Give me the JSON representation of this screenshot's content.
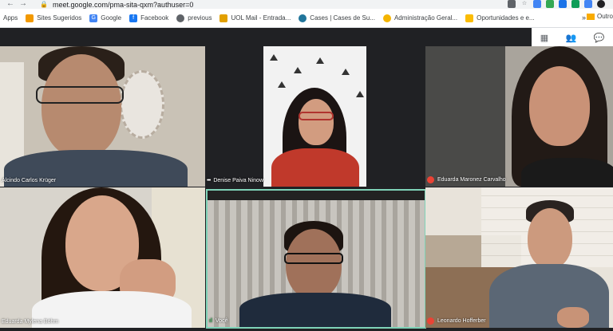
{
  "browser": {
    "url": "meet.google.com/pma-sita-qxm?authuser=0"
  },
  "bookmarks": [
    {
      "label": "Apps",
      "icon": "apps-icon",
      "color": "#4285f4"
    },
    {
      "label": "Sites Sugeridos",
      "icon": "bookmark-icon",
      "color": "#f29900"
    },
    {
      "label": "Google",
      "icon": "google-icon",
      "color": "#4285f4"
    },
    {
      "label": "Facebook",
      "icon": "facebook-icon",
      "color": "#1877f2"
    },
    {
      "label": "previous",
      "icon": "globe-icon",
      "color": "#5f6368"
    },
    {
      "label": "UOL Mail - Entrada...",
      "icon": "uol-icon",
      "color": "#e2a000"
    },
    {
      "label": "Cases | Cases de Su...",
      "icon": "wordpress-icon",
      "color": "#21759b"
    },
    {
      "label": "Administração Geral...",
      "icon": "emoji-icon",
      "color": "#f4b400"
    },
    {
      "label": "Oportunidades e e...",
      "icon": "trophy-icon",
      "color": "#fbbc04"
    }
  ],
  "bookmarks_more": "»",
  "bookmarks_other": "Outro",
  "participants": [
    {
      "name": "Alcindo Carlos Krüger",
      "indicator": "none"
    },
    {
      "name": "Denise Paiva Ninow",
      "indicator": "speaking"
    },
    {
      "name": "Eduarda Maronez Carvalho",
      "indicator": "muted"
    },
    {
      "name": "Eduarda Mylena Böhm",
      "indicator": "none"
    },
    {
      "name": "Você",
      "indicator": "active"
    },
    {
      "name": "Leonardo Hofferber",
      "indicator": "muted"
    }
  ],
  "colors": {
    "active_border": "#7fd3b8",
    "muted": "#ea4335",
    "speaking": "#34a853"
  }
}
